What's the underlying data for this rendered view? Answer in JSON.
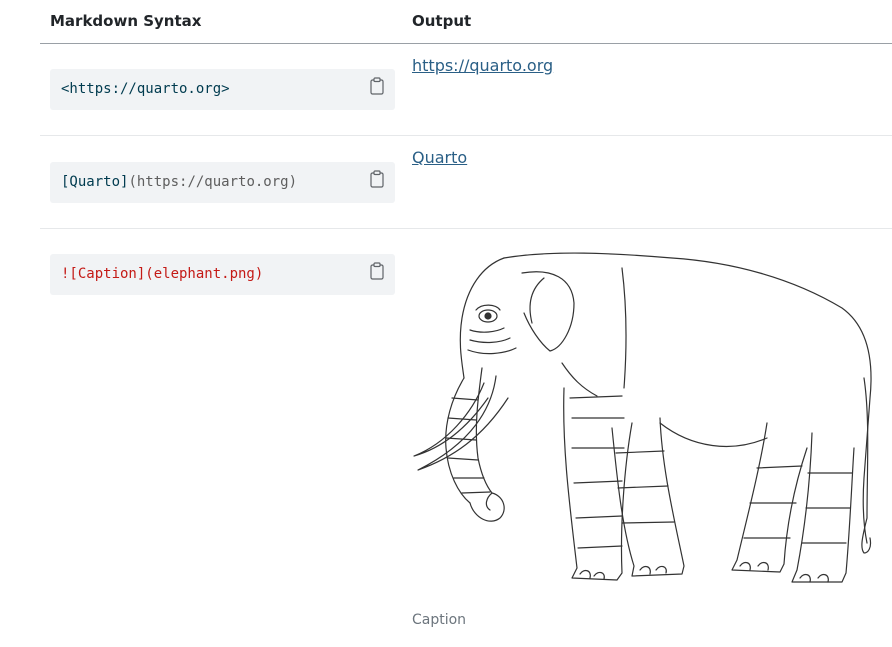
{
  "table": {
    "headers": {
      "syntax": "Markdown Syntax",
      "output": "Output"
    },
    "rows": [
      {
        "syntax": "<https://quarto.org>",
        "output": "https://quarto.org"
      },
      {
        "syntax_bracket_text": "[Quarto]",
        "syntax_url": "(https://quarto.org)",
        "output": "Quarto"
      },
      {
        "syntax": "![Caption](elephant.png)",
        "image_alt": "elephant",
        "caption": "Caption"
      }
    ]
  },
  "icons": {
    "copy": "clipboard-icon"
  },
  "colors": {
    "link": "#2a5f86",
    "code_bg": "#f1f3f5",
    "code_red": "#c41a16"
  }
}
